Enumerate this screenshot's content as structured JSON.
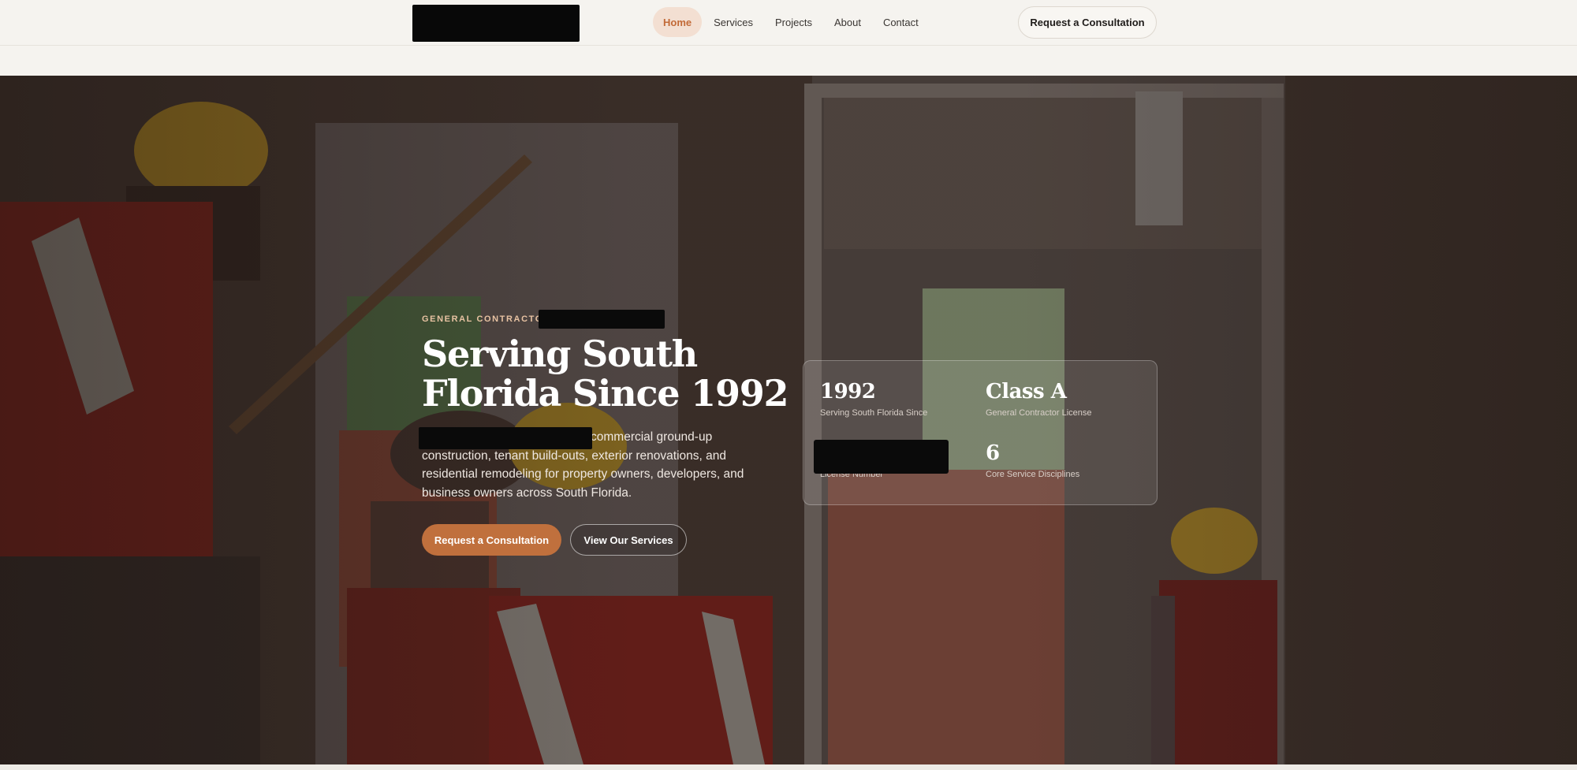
{
  "header": {
    "nav_items": [
      {
        "label": "Home",
        "active": true
      },
      {
        "label": "Services",
        "active": false
      },
      {
        "label": "Projects",
        "active": false
      },
      {
        "label": "About",
        "active": false
      },
      {
        "label": "Contact",
        "active": false
      }
    ],
    "cta_label": "Request a Consultation"
  },
  "hero": {
    "eyebrow": "GENERAL CONTRACTOR",
    "title": "Serving South Florida Since 1992",
    "description": "commercial ground-up construction, tenant build-outs, exterior renovations, and residential remodeling for property owners, developers, and business owners across South Florida.",
    "primary_button": "Request a Consultation",
    "secondary_button": "View Our Services"
  },
  "stats": [
    {
      "value": "1992",
      "label": "Serving South Florida Since"
    },
    {
      "value": "Class A",
      "label": "General Contractor License"
    },
    {
      "value": "",
      "label": "License Number"
    },
    {
      "value": "6",
      "label": "Core Service Disciplines"
    }
  ],
  "colors": {
    "accent": "#c0703d",
    "nav_active_bg": "#f3dfd2",
    "page_bg": "#f5f3ef"
  }
}
